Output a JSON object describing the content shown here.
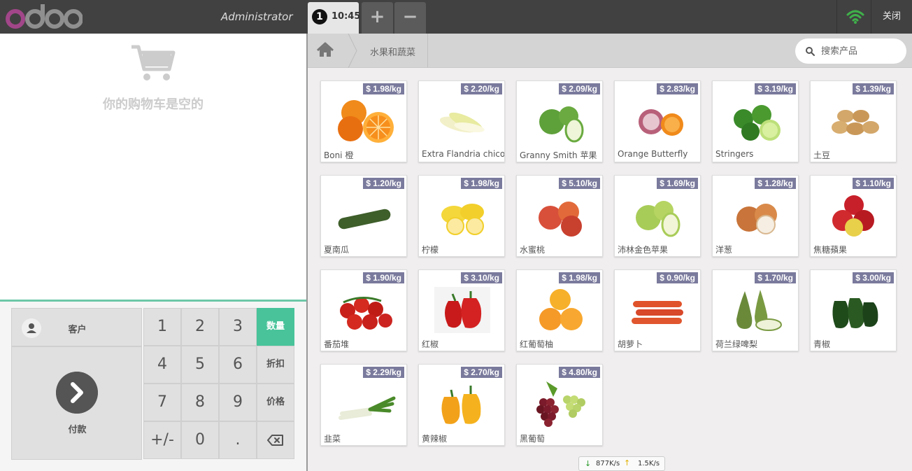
{
  "header": {
    "logo_text": "odoo",
    "username": "Administrator",
    "order": {
      "number": "1",
      "time": "10:45"
    },
    "add_order_label": "+",
    "remove_order_label": "−",
    "close_label": "关闭",
    "wifi_icon": "wifi-icon",
    "colors": {
      "bar": "#414141",
      "wifi": "#3fb04a"
    }
  },
  "cart": {
    "empty_text": "你的购物车是空的"
  },
  "numpad": {
    "customer_label": "客户",
    "payment_label": "付款",
    "keys": [
      "1",
      "2",
      "3",
      "4",
      "5",
      "6",
      "7",
      "8",
      "9",
      "+/-",
      "0",
      "."
    ],
    "modes": [
      "数量",
      "折扣",
      "价格"
    ],
    "active_mode": "数量",
    "accent_color": "#48c39a"
  },
  "breadcrumb": {
    "home_icon": "home-icon",
    "category": "水果和蔬菜"
  },
  "search": {
    "placeholder": "搜索产品"
  },
  "products": [
    {
      "name": "Boni 橙",
      "price": "$ 1.98/kg"
    },
    {
      "name": "Extra Flandria chicory",
      "price": "$ 2.20/kg"
    },
    {
      "name": "Granny Smith 苹果",
      "price": "$ 2.09/kg"
    },
    {
      "name": "Orange Butterfly",
      "price": "$ 2.83/kg"
    },
    {
      "name": "Stringers",
      "price": "$ 3.19/kg"
    },
    {
      "name": "土豆",
      "price": "$ 1.39/kg"
    },
    {
      "name": "夏南瓜",
      "price": "$ 1.20/kg"
    },
    {
      "name": "柠檬",
      "price": "$ 1.98/kg"
    },
    {
      "name": "水蜜桃",
      "price": "$ 5.10/kg"
    },
    {
      "name": "沛林金色苹果",
      "price": "$ 1.69/kg"
    },
    {
      "name": "洋葱",
      "price": "$ 1.28/kg"
    },
    {
      "name": "焦糖蘋果",
      "price": "$ 1.10/kg"
    },
    {
      "name": "番茄堆",
      "price": "$ 1.90/kg"
    },
    {
      "name": "红椒",
      "price": "$ 3.10/kg"
    },
    {
      "name": "红葡萄柚",
      "price": "$ 1.98/kg"
    },
    {
      "name": "胡萝卜",
      "price": "$ 0.90/kg"
    },
    {
      "name": "荷兰绿啤梨",
      "price": "$ 1.70/kg"
    },
    {
      "name": "青椒",
      "price": "$ 3.00/kg"
    },
    {
      "name": "韭菜",
      "price": "$ 2.29/kg"
    },
    {
      "name": "黄辣椒",
      "price": "$ 2.70/kg"
    },
    {
      "name": "黑葡萄",
      "price": "$ 4.80/kg"
    }
  ],
  "netspeed": {
    "down": "877K/s",
    "up": "1.5K/s"
  }
}
